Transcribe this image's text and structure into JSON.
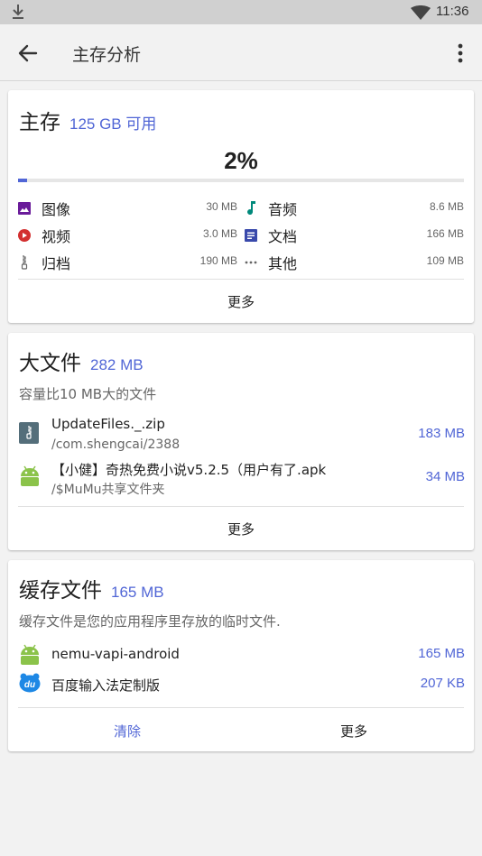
{
  "status_bar": {
    "time": "11:36"
  },
  "toolbar": {
    "title": "主存分析"
  },
  "storage": {
    "title": "主存",
    "available": "125 GB 可用",
    "percent_label": "2%",
    "percent_used": 0.02,
    "categories": [
      {
        "label": "图像",
        "size": "30 MB",
        "icon": "image-icon",
        "color": "#6a1b9a"
      },
      {
        "label": "音频",
        "size": "8.6 MB",
        "icon": "music-note-icon",
        "color": "#00897b"
      },
      {
        "label": "视频",
        "size": "3.0 MB",
        "icon": "play-circle-icon",
        "color": "#d32f2f"
      },
      {
        "label": "文档",
        "size": "166 MB",
        "icon": "document-icon",
        "color": "#3949ab"
      },
      {
        "label": "归档",
        "size": "190 MB",
        "icon": "zipper-icon",
        "color": "#666666"
      },
      {
        "label": "其他",
        "size": "109 MB",
        "icon": "more-horiz-icon",
        "color": "#666666"
      }
    ],
    "more_label": "更多"
  },
  "large_files": {
    "title": "大文件",
    "size": "282 MB",
    "subtitle": "容量比10 MB大的文件",
    "files": [
      {
        "name": "UpdateFiles._.zip",
        "path": "/com.shengcai/2388",
        "size": "183 MB",
        "icon": "zip-file-icon"
      },
      {
        "name": "【小健】奇热免费小说v5.2.5（用户有了.apk",
        "path": "/$MuMu共享文件夹",
        "size": "34 MB",
        "icon": "android-icon"
      }
    ],
    "more_label": "更多"
  },
  "cache": {
    "title": "缓存文件",
    "size": "165 MB",
    "subtitle": "缓存文件是您的应用程序里存放的临时文件.",
    "apps": [
      {
        "name": "nemu-vapi-android",
        "size": "165 MB",
        "icon": "android-icon"
      },
      {
        "name": "百度输入法定制版",
        "size": "207 KB",
        "icon": "baidu-input-icon",
        "badge_text": "du"
      }
    ],
    "clear_label": "清除",
    "more_label": "更多"
  },
  "colors": {
    "accent": "#5166d6",
    "android": "#8bc34a"
  }
}
